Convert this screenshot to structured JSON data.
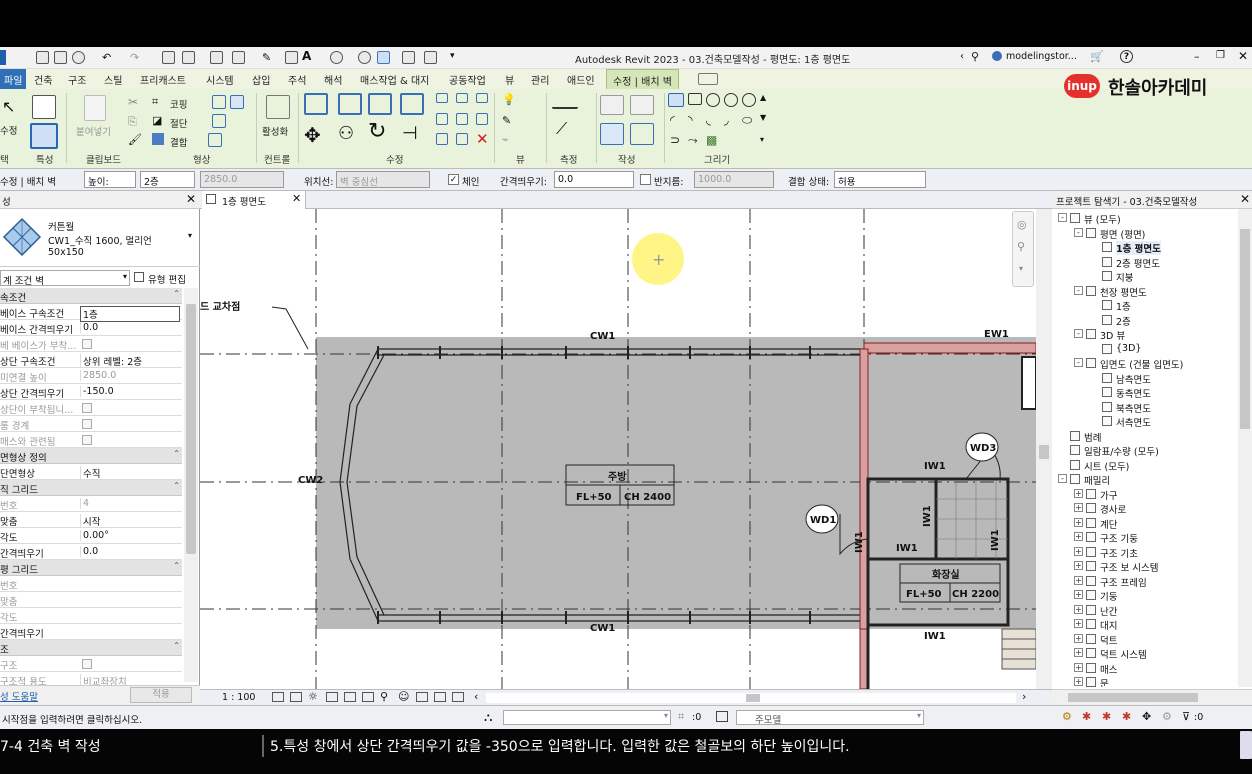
{
  "title_bar": {
    "app_title": "Autodesk Revit 2023 - 03.건축모델작성 - 평면도: 1층 평면도",
    "user": "modelingstor...",
    "search_icon": "binoculars-icon",
    "help_label": "?"
  },
  "watermark": {
    "logo_text": "inup",
    "brand": "한솔아카데미"
  },
  "ribbon_tabs": [
    {
      "label": "파일"
    },
    {
      "label": "건축"
    },
    {
      "label": "구조"
    },
    {
      "label": "스틸"
    },
    {
      "label": "프리캐스트"
    },
    {
      "label": "시스템"
    },
    {
      "label": "삽입"
    },
    {
      "label": "주석"
    },
    {
      "label": "해석"
    },
    {
      "label": "매스작업 & 대지"
    },
    {
      "label": "공동작업"
    },
    {
      "label": "뷰"
    },
    {
      "label": "관리"
    },
    {
      "label": "애드인"
    },
    {
      "label": "수정 | 배치 벽"
    }
  ],
  "ribbon": {
    "modify_label": "수정",
    "select_label": "택",
    "properties_label": "특성",
    "clipboard_label": "클립보드",
    "paste_label": "붙여넣기",
    "cope_label": "코핑",
    "cut_label": "절단",
    "join_label": "결합",
    "geometry_label": "형상",
    "activate_label": "활성화",
    "controls_label": "컨트롤",
    "modify_group_label": "수정",
    "view_label": "뷰",
    "measure_label": "측정",
    "create_label": "작성",
    "draw_label": "그리기"
  },
  "options_bar": {
    "context_label": "수정 | 배치 벽",
    "height_mode": "높이:",
    "level_value": "2층",
    "height_value": "2850.0",
    "location_line_label": "위치선:",
    "location_line_value": "벽 중심선",
    "chain_label": "체인",
    "offset_label": "간격띄우기:",
    "offset_value": "0.0",
    "radius_label": "반지름:",
    "radius_value": "1000.0",
    "join_status_label": "결합 상태:",
    "join_status_value": "허용"
  },
  "properties": {
    "header": "성",
    "type_family": "커튼월",
    "type_name": "CW1_수직 1600, 멀리언",
    "type_size": "50x150",
    "instance_filter": "계 조건 벽",
    "edit_type_label": "유형 편집",
    "groups": [
      {
        "name": "속조건",
        "rows": [
          {
            "k": "베이스 구속조건",
            "v": "1층",
            "gray": false
          },
          {
            "k": "베이스 간격띄우기",
            "v": "0.0",
            "gray": false
          },
          {
            "k": "베 베이스가 부착...",
            "v": "",
            "gray": true
          },
          {
            "k": "상단 구속조건",
            "v": "상위 레벨: 2층",
            "gray": false
          },
          {
            "k": "미연결 높이",
            "v": "2850.0",
            "gray": true
          },
          {
            "k": "상단 간격띄우기",
            "v": "-150.0",
            "gray": false
          },
          {
            "k": "상단이 부착됩니...",
            "v": "",
            "gray": true
          },
          {
            "k": "룸 경계",
            "v": "",
            "gray": true
          },
          {
            "k": "매스와 관련됨",
            "v": "",
            "gray": true
          }
        ]
      },
      {
        "name": "면형상 정의",
        "rows": [
          {
            "k": "단면형상",
            "v": "수직",
            "gray": false
          }
        ]
      },
      {
        "name": "직 그리드",
        "rows": [
          {
            "k": "번호",
            "v": "4",
            "gray": true
          },
          {
            "k": "맞춤",
            "v": "시작",
            "gray": false
          },
          {
            "k": "각도",
            "v": "0.00°",
            "gray": false
          },
          {
            "k": "간격띄우기",
            "v": "0.0",
            "gray": false
          }
        ]
      },
      {
        "name": "평 그리드",
        "rows": [
          {
            "k": "번호",
            "v": "",
            "gray": true
          },
          {
            "k": "맞춤",
            "v": "",
            "gray": true
          },
          {
            "k": "각도",
            "v": "",
            "gray": true
          },
          {
            "k": "간격띄우기",
            "v": "",
            "gray": false
          }
        ]
      },
      {
        "name": "조",
        "rows": [
          {
            "k": "구조",
            "v": "",
            "gray": true
          },
          {
            "k": "구조적 용도",
            "v": "비교좌장치",
            "gray": true
          }
        ]
      }
    ],
    "help_link": "성 도움말",
    "apply_button": "적용"
  },
  "view": {
    "tab_label": "1층 평면도",
    "scale": "1 : 100",
    "annotations": {
      "intersection": "드 교차점",
      "cw1_top": "CW1",
      "cw1_bottom": "CW1",
      "cw2": "CW2",
      "ew1": "EW1",
      "iw1_a": "IW1",
      "iw1_b": "IW1",
      "iw1_c": "IW1",
      "iw1_v1": "IW1",
      "iw1_v2": "IW1",
      "iw1_v3": "IW1",
      "wd1": "WD1",
      "wd3": "WD3",
      "room1_name": "주방",
      "room1_fl": "FL+50",
      "room1_ch": "CH 2400",
      "room2_name": "화장실",
      "room2_fl": "FL+50",
      "room2_ch": "CH 2200"
    }
  },
  "browser": {
    "header": "프로젝트 탐색기 - 03.건축모델작성",
    "nodes": [
      {
        "label": "뷰 (모두)",
        "level": 0,
        "exp": "-"
      },
      {
        "label": "평면 (평면)",
        "level": 1,
        "exp": "-"
      },
      {
        "label": "1층 평면도",
        "level": 2,
        "exp": "",
        "selected": true
      },
      {
        "label": "2층 평면도",
        "level": 2,
        "exp": ""
      },
      {
        "label": "지붕",
        "level": 2,
        "exp": ""
      },
      {
        "label": "천장 평면도",
        "level": 1,
        "exp": "-"
      },
      {
        "label": "1층",
        "level": 2,
        "exp": ""
      },
      {
        "label": "2층",
        "level": 2,
        "exp": ""
      },
      {
        "label": "3D 뷰",
        "level": 1,
        "exp": "-"
      },
      {
        "label": "{3D}",
        "level": 2,
        "exp": ""
      },
      {
        "label": "입면도 (건물 입면도)",
        "level": 1,
        "exp": "-"
      },
      {
        "label": "남측면도",
        "level": 2,
        "exp": ""
      },
      {
        "label": "동측면도",
        "level": 2,
        "exp": ""
      },
      {
        "label": "북측면도",
        "level": 2,
        "exp": ""
      },
      {
        "label": "서측면도",
        "level": 2,
        "exp": ""
      },
      {
        "label": "범례",
        "level": 0,
        "exp": ""
      },
      {
        "label": "일람표/수량 (모두)",
        "level": 0,
        "exp": ""
      },
      {
        "label": "시트 (모두)",
        "level": 0,
        "exp": ""
      },
      {
        "label": "패밀리",
        "level": 0,
        "exp": "-"
      },
      {
        "label": "가구",
        "level": 1,
        "exp": "+"
      },
      {
        "label": "경사로",
        "level": 1,
        "exp": "+"
      },
      {
        "label": "계단",
        "level": 1,
        "exp": "+"
      },
      {
        "label": "구조 기둥",
        "level": 1,
        "exp": "+"
      },
      {
        "label": "구조 기초",
        "level": 1,
        "exp": "+"
      },
      {
        "label": "구조 보 시스템",
        "level": 1,
        "exp": "+"
      },
      {
        "label": "구조 프레임",
        "level": 1,
        "exp": "+"
      },
      {
        "label": "기둥",
        "level": 1,
        "exp": "+"
      },
      {
        "label": "난간",
        "level": 1,
        "exp": "+"
      },
      {
        "label": "대지",
        "level": 1,
        "exp": "+"
      },
      {
        "label": "덕트",
        "level": 1,
        "exp": "+"
      },
      {
        "label": "덕트 시스템",
        "level": 1,
        "exp": "+"
      },
      {
        "label": "매스",
        "level": 1,
        "exp": "+"
      },
      {
        "label": "문",
        "level": 1,
        "exp": "+"
      }
    ]
  },
  "status_bar": {
    "message": "시작점을 입력하려면 클릭하십시오.",
    "selection_count": ":0",
    "main_model": "주모델",
    "filter_count": ":0"
  },
  "caption": {
    "chapter": "7-4 건축 벽 작성",
    "instruction": "5.특성 창에서 상단 간격띄우기 값을 -350으로 입력합니다. 입력한 값은 철골보의 하단 높이입니다."
  },
  "colors": {
    "ribbon_bg": "#e9f2da",
    "file_tab": "#2f6fb5",
    "model_fill": "#b9b9b9",
    "cursor_highlight": "#fff47a",
    "brand_red": "#e5302b"
  }
}
